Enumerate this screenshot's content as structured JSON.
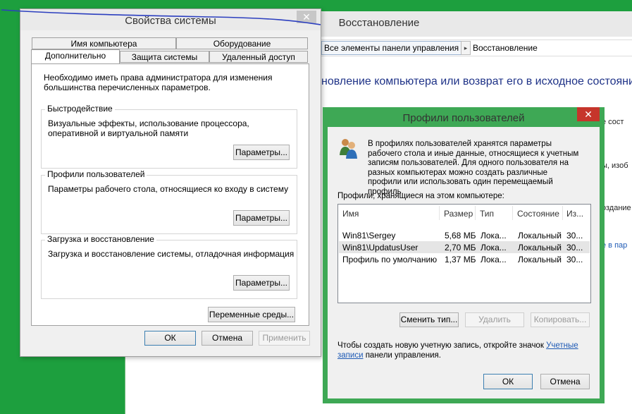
{
  "recovery_window": {
    "title": "Восстановление",
    "address_bar": {
      "crumb": "Все элементы панели управления",
      "separator": "▸",
      "current": "Восстановление"
    },
    "heading": "новление компьютера или возврат его в исходное состояние",
    "side_texts": [
      "е сост",
      "ы, изоб",
      "оздание"
    ],
    "side_link": "е в пар"
  },
  "system_properties": {
    "title": "Свойства системы",
    "close_label": "✕",
    "tabs_row1": [
      "Имя компьютера",
      "Оборудование"
    ],
    "tabs_row2": [
      "Дополнительно",
      "Защита системы",
      "Удаленный доступ"
    ],
    "admin_note": "Необходимо иметь права администратора для изменения большинства перечисленных параметров.",
    "groups": [
      {
        "label": "Быстродействие",
        "text": "Визуальные эффекты, использование процессора, оперативной и виртуальной памяти",
        "button": "Параметры..."
      },
      {
        "label": "Профили пользователей",
        "text": "Параметры рабочего стола, относящиеся ко входу в систему",
        "button": "Параметры..."
      },
      {
        "label": "Загрузка и восстановление",
        "text": "Загрузка и восстановление системы, отладочная информация",
        "button": "Параметры..."
      }
    ],
    "env_button": "Переменные среды...",
    "ok": "ОК",
    "cancel": "Отмена",
    "apply": "Применить"
  },
  "user_profiles": {
    "title": "Профили пользователей",
    "close_label": "✕",
    "description": "В профилях пользователей хранятся параметры рабочего стола и иные данные, относящиеся к учетным записям пользователей. Для одного пользователя на разных компьютерах можно создать различные профили или использовать один перемещаемый профиль.",
    "list_label": "Профили, хранящиеся на этом компьютере:",
    "columns": [
      "Имя",
      "Размер",
      "Тип",
      "Состояние",
      "Из..."
    ],
    "rows": [
      {
        "name": "Win81\\Sergey",
        "size": "5,68 МБ",
        "type": "Лока...",
        "state": "Локальный",
        "modified": "30..."
      },
      {
        "name": "Win81\\UpdatusUser",
        "size": "2,70 МБ",
        "type": "Лока...",
        "state": "Локальный",
        "modified": "30..."
      },
      {
        "name": "Профиль по умолчанию",
        "size": "1,37 МБ",
        "type": "Лока...",
        "state": "Локальный",
        "modified": "30..."
      }
    ],
    "change_type": "Сменить тип...",
    "delete": "Удалить",
    "copy": "Копировать...",
    "footer_text_before": "Чтобы создать новую учетную запись, откройте значок",
    "footer_link": "Учетные записи",
    "footer_text_after": "панели управления.",
    "ok": "ОК",
    "cancel": "Отмена"
  },
  "colors": {
    "desktop_green": "#1d9f3e",
    "profiles_frame": "#3ea855",
    "close_red": "#c6352b",
    "link_blue": "#1e5ab5",
    "heading_blue": "#1e3287"
  }
}
